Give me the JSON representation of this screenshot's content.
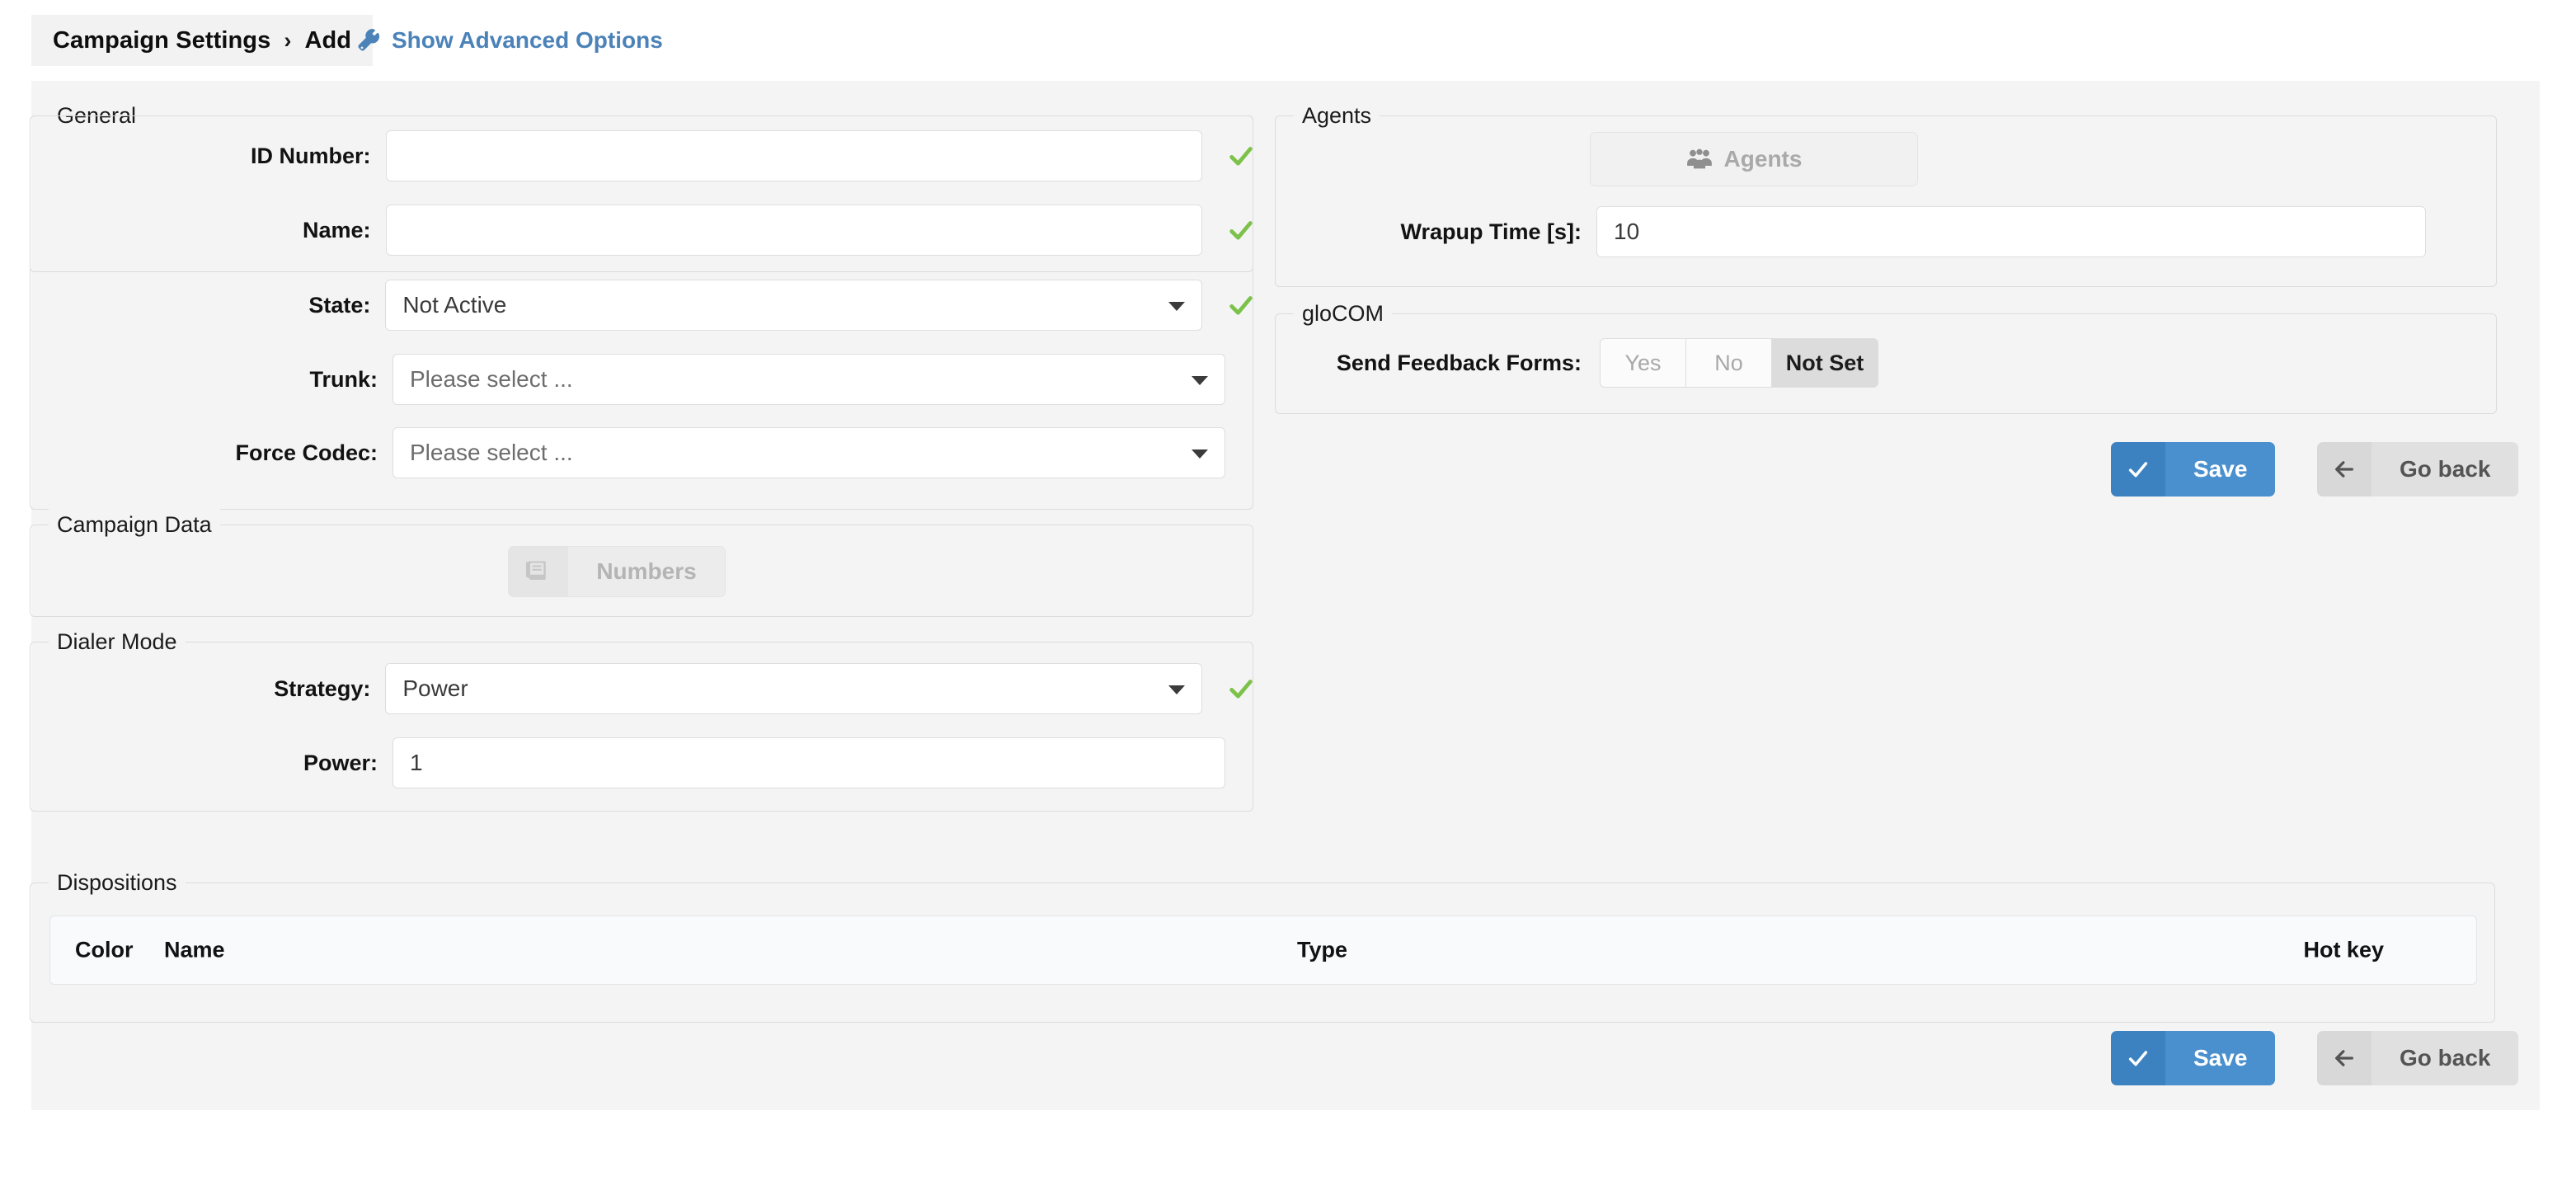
{
  "header": {
    "breadcrumb_root": "Campaign Settings",
    "breadcrumb_sep": "›",
    "breadcrumb_current": "Add",
    "advanced_options_label": "Show Advanced Options",
    "advanced_options_icon": "wrench-icon",
    "link_color": "#4b82b8"
  },
  "general": {
    "legend": "General",
    "fields": {
      "id_number": {
        "label": "ID Number:",
        "value": "",
        "placeholder": "",
        "valid": true
      },
      "name": {
        "label": "Name:",
        "value": "",
        "placeholder": "",
        "valid": true
      },
      "state": {
        "label": "State:",
        "value": "Not Active",
        "valid": true
      },
      "trunk": {
        "label": "Trunk:",
        "value": "Please select ..."
      },
      "force_codec": {
        "label": "Force Codec:",
        "value": "Please select ..."
      }
    }
  },
  "campaign_data": {
    "legend": "Campaign Data",
    "numbers_button": {
      "label": "Numbers",
      "icon": "address-book-icon",
      "disabled": true
    }
  },
  "dialer_mode": {
    "legend": "Dialer Mode",
    "fields": {
      "strategy": {
        "label": "Strategy:",
        "value": "Power",
        "valid": true
      },
      "power": {
        "label": "Power:",
        "value": "1"
      }
    }
  },
  "dispositions": {
    "legend": "Dispositions",
    "columns": [
      "Color",
      "Name",
      "Type",
      "Hot key"
    ],
    "rows": []
  },
  "agents": {
    "legend": "Agents",
    "agents_button": {
      "label": "Agents",
      "icon": "users-icon",
      "disabled": true
    },
    "wrapup_time": {
      "label": "Wrapup Time [s]:",
      "value": "10"
    }
  },
  "glocom": {
    "legend": "gloCOM",
    "send_feedback_forms": {
      "label": "Send Feedback Forms:",
      "options": [
        "Yes",
        "No",
        "Not Set"
      ],
      "selected": "Not Set"
    }
  },
  "actions": {
    "save_label": "Save",
    "save_icon": "check-icon",
    "go_back_label": "Go back",
    "go_back_icon": "arrow-left-icon",
    "save_color": "#4a90ce",
    "back_color": "#e0e0e0"
  },
  "validation": {
    "check_icon": "check-icon",
    "check_color": "#7cc24a"
  }
}
